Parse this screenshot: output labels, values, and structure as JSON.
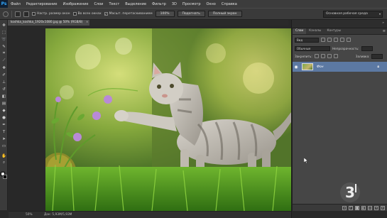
{
  "app": {
    "logo": "Ps"
  },
  "menu": [
    "Файл",
    "Редактирование",
    "Изображение",
    "Слои",
    "Текст",
    "Выделение",
    "Фильтр",
    "3D",
    "Просмотр",
    "Окно",
    "Справка"
  ],
  "options": {
    "checkbox_resize": "Настр. размер окон",
    "checkbox_all_windows": "Во всех окнах",
    "checkbox_scrubby": "Масшт. перетаскиванием",
    "btn_100": "100%",
    "btn_fit": "Подогнать",
    "btn_fullscreen": "Полный экран",
    "workspace": "Основная рабочая среда"
  },
  "document_tab": {
    "title": "koshka_koshka_1920x1080.jpg @ 50% (RGB/8)"
  },
  "status": {
    "zoom": "50%",
    "doc": "Док: 5,93M/5,93M"
  },
  "layers_panel": {
    "tabs": [
      "Слои",
      "Каналы",
      "Контуры"
    ],
    "kind_label": "Вид",
    "blend_mode": "Обычные",
    "opacity_label": "Непрозрачность:",
    "lock_label": "Закрепить:",
    "fill_label": "Заливка:",
    "layer_name": "Фон"
  },
  "colors": {
    "chrome": "#3c3c3c",
    "panel": "#464646",
    "selection": "#5c79a3"
  },
  "icons": [
    "zoom-in-icon",
    "zoom-out-icon",
    "eye-icon",
    "lock-icon",
    "link-icon",
    "fx-icon",
    "trash-icon"
  ]
}
